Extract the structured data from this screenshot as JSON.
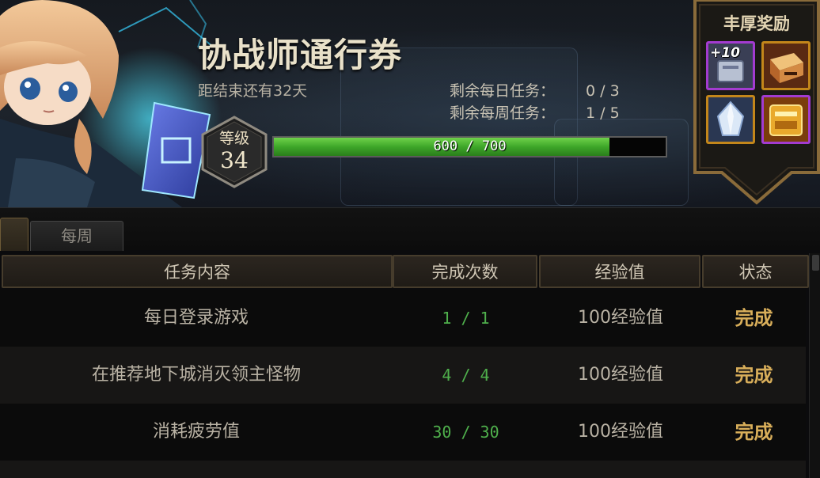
{
  "header": {
    "title": "协战师通行券",
    "countdown": "距结束还有32天",
    "daily_remaining_label": "剩余每日任务：",
    "daily_remaining_value": "0 / 3",
    "weekly_remaining_label": "剩余每周任务：",
    "weekly_remaining_value": "1 / 5"
  },
  "level": {
    "label": "等级",
    "value": "34"
  },
  "xp": {
    "text": "600 / 700",
    "current": 600,
    "max": 700
  },
  "rewards": {
    "title": "丰厚奖励",
    "items": [
      {
        "icon": "enhance-plus10-icon",
        "tag": "+10"
      },
      {
        "icon": "treasure-box-icon"
      },
      {
        "icon": "crystal-icon"
      },
      {
        "icon": "golden-chest-icon"
      }
    ]
  },
  "tabs": [
    {
      "label": ""
    },
    {
      "label": "每周"
    }
  ],
  "table": {
    "headers": [
      "任务内容",
      "完成次数",
      "经验值",
      "状态"
    ],
    "rows": [
      {
        "task": "每日登录游戏",
        "count": "1 / 1",
        "exp": "100经验值",
        "status": "完成"
      },
      {
        "task": "在推荐地下城消灭领主怪物",
        "count": "4 / 4",
        "exp": "100经验值",
        "status": "完成"
      },
      {
        "task": "消耗疲劳值",
        "count": "30 / 30",
        "exp": "100经验值",
        "status": "完成"
      }
    ]
  },
  "colors": {
    "xp_fill": "#3ea629",
    "status_done": "#d8ae5a",
    "count_green": "#4fb04c",
    "gold_frame": "#8a6b3a"
  }
}
